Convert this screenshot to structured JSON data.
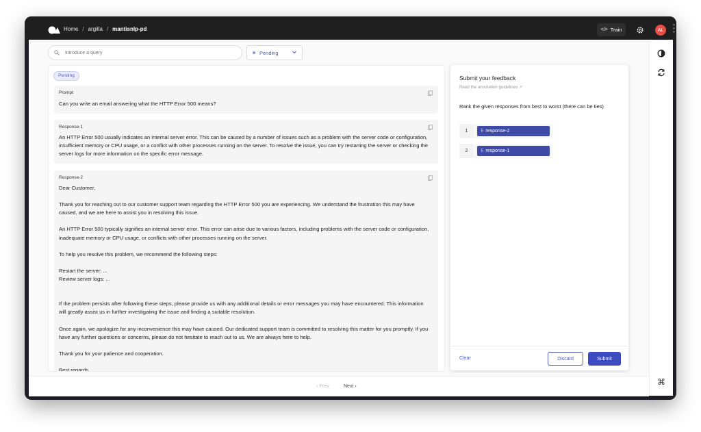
{
  "topbar": {
    "breadcrumbs": [
      "Home",
      "argilla",
      "mantisnlp-pd"
    ],
    "separator": "/",
    "train_label": "Train",
    "avatar_initials": "AL",
    "avatar_color": "#ea4d46"
  },
  "toolbar": {
    "search_placeholder": "Introduce a query",
    "status_value": "Pending"
  },
  "record": {
    "status_badge": "Pending",
    "fields": [
      {
        "title": "Prompt",
        "text": "Can you write an email answering what the HTTP Error 500 means?"
      },
      {
        "title": "Response-1",
        "text": "An HTTP Error 500 usually indicates an internal server error. This can be caused by a number of issues such as a problem with the server code or configuration, insufficient memory or CPU usage, or a conflict with other processes running on the server. To resolve the issue, you can try restarting the server or checking the server logs for more information on the specific error message."
      },
      {
        "title": "Response-2",
        "text": "Dear Customer,\n\nThank you for reaching out to our customer support team regarding the HTTP Error 500 you are experiencing. We understand the frustration this may have caused, and we are here to assist you in resolving this issue.\n\nAn HTTP Error 500 typically signifies an internal server error. This error can arise due to various factors, including problems with the server code or configuration, inadequate memory or CPU usage, or conflicts with other processes running on the server.\n\nTo help you resolve this problem, we recommend the following steps:\n\nRestart the server: ...\nReview server logs:  ...\n\n\nIf the problem persists after following these steps, please provide us with any additional details or error messages you may have encountered. This information will greatly assist us in further investigating the issue and finding a suitable resolution.\n\nOnce again, we apologize for any inconvenience this may have caused. Our dedicated support team is committed to resolving this matter for you promptly. If you have any further questions or concerns, please do not hesitate to reach out to us. We are always here to help.\n\nThank you for your patience and cooperation.\n\nBest regards,"
      }
    ]
  },
  "feedback": {
    "title": "Submit your feedback",
    "guidelines_link": "Read the annotation guidelines",
    "question": "Rank the given responses from best to worst (there can be ties)",
    "rankings": [
      {
        "rank": "1",
        "item": "response-2"
      },
      {
        "rank": "2",
        "item": "response-1"
      }
    ],
    "clear_label": "Clear",
    "discard_label": "Discard",
    "submit_label": "Submit"
  },
  "pagination": {
    "prev_label": "Prev",
    "next_label": "Next"
  },
  "colors": {
    "accent": "#4c58c5",
    "chip": "#3e4aa6"
  }
}
